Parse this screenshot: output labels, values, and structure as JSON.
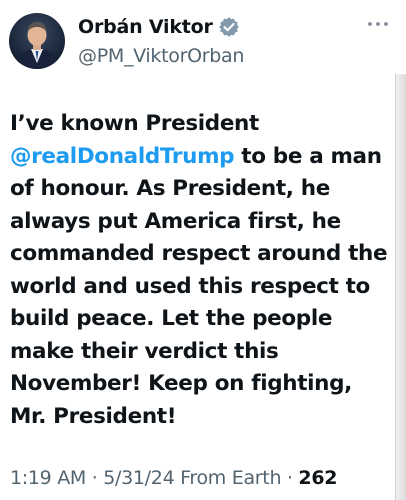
{
  "author": {
    "name": "Orbán Viktor",
    "handle": "@PM_ViktorOrban",
    "verified_icon": "verified-badge-icon",
    "avatar_icon": "profile-photo-icon"
  },
  "tweet": {
    "text_before": "I’ve known President ",
    "mention": "@realDonaldTrump",
    "text_after": " to be a man of honour. As President, he always put America first, he commanded respect around the world and used this respect to build peace. Let the people make their verdict this November! Keep on fighting, Mr. President!"
  },
  "meta": {
    "time": "1:19 AM",
    "date": "5/31/24",
    "source": "From Earth",
    "views": "262",
    "separator": " · "
  },
  "colors": {
    "text": "#0f1419",
    "secondary": "#536471",
    "accent": "#1d9bf0"
  }
}
